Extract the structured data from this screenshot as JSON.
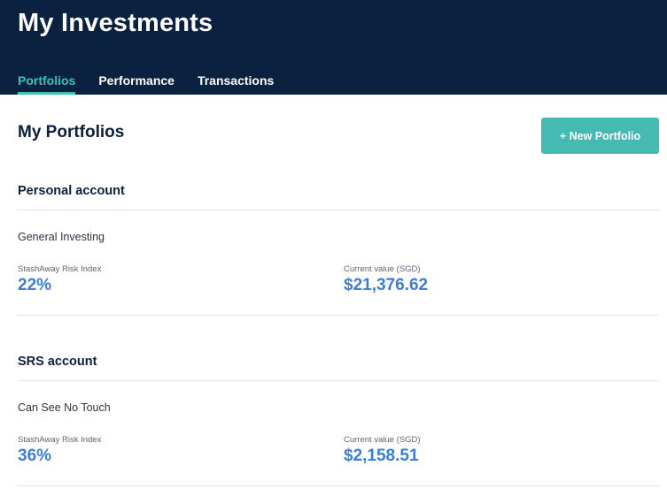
{
  "header": {
    "title": "My Investments",
    "tabs": [
      {
        "label": "Portfolios",
        "active": true
      },
      {
        "label": "Performance",
        "active": false
      },
      {
        "label": "Transactions",
        "active": false
      }
    ]
  },
  "main": {
    "title": "My Portfolios",
    "new_portfolio_label": "+ New Portfolio",
    "accounts": [
      {
        "name": "Personal account",
        "portfolio": "General Investing",
        "risk_label": "StashAway Risk Index",
        "risk_value": "22%",
        "value_label": "Current value (SGD)",
        "value": "$21,376.62"
      },
      {
        "name": "SRS account",
        "portfolio": "Can See No Touch",
        "risk_label": "StashAway Risk Index",
        "risk_value": "36%",
        "value_label": "Current value (SGD)",
        "value": "$2,158.51"
      }
    ]
  },
  "colors": {
    "header_bg": "#0a2240",
    "accent": "#3cc3b8",
    "button": "#45bab3",
    "value_blue": "#3a7ed6"
  }
}
